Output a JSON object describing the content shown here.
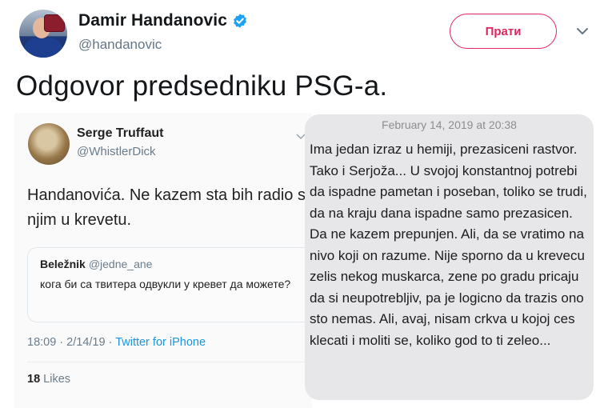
{
  "header": {
    "display_name": "Damir Handanovic",
    "handle": "@handanovic",
    "follow_label": "Прати",
    "verified_color": "#1da1f2",
    "follow_color": "#e0245e"
  },
  "tweet": {
    "text": "Odgovor predsedniku PSG-a."
  },
  "embedded_tweet": {
    "display_name": "Serge Truffaut",
    "handle": "@WhistlerDick",
    "text": "Handanovića. Ne kazem sta bih radio s njim u krevetu.",
    "quote": {
      "name": "Beležnik",
      "handle": "@jedne_ane",
      "text": "кога би са твитера одвукли у кревет да можете?"
    },
    "time": "18:09 · 2/14/19 · ",
    "source": "Twitter for iPhone",
    "likes_count": "18",
    "likes_label": "Likes"
  },
  "message": {
    "date": "February 14, 2019 at 20:38",
    "text": "Ima jedan izraz u hemiji, prezasiceni rastvor. Tako i Serjoža... U svojoj konstantnoj potrebi da ispadne pametan i poseban, toliko se trudi, da na kraju dana ispadne samo prezasicen. Da ne kazem prepunjen. Ali, da se vratimo na nivo koji on razume. Nije sporno da u krevecu zelis nekog muskarca, zene po gradu pricaju da si neupotrebljiv, pa je logicno da trazis ono sto nemas. Ali, avaj, nisam crkva u kojoj ces klecati i moliti se, koliko god to ti zeleo..."
  }
}
